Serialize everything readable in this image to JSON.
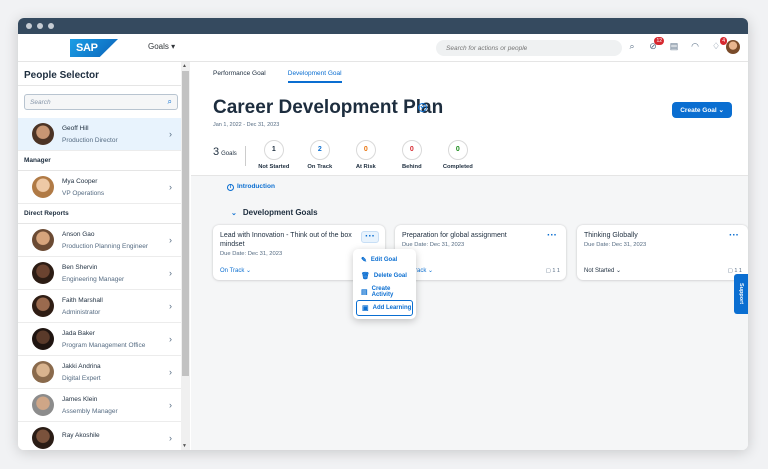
{
  "shell": {
    "logo": "SAP",
    "app_menu": "Goals",
    "search_placeholder": "Search for actions or people",
    "notif_badge": "12",
    "bell_badge": "4"
  },
  "sidebar": {
    "title": "People Selector",
    "search_placeholder": "Search",
    "current": {
      "name": "Geoff Hill",
      "role": "Production Director"
    },
    "manager_heading": "Manager",
    "manager": {
      "name": "Mya Cooper",
      "role": "VP Operations"
    },
    "reports_heading": "Direct Reports",
    "reports": [
      {
        "name": "Anson Gao",
        "role": "Production Planning Engineer"
      },
      {
        "name": "Ben Shervin",
        "role": "Engineering Manager"
      },
      {
        "name": "Faith Marshall",
        "role": "Administrator"
      },
      {
        "name": "Jada Baker",
        "role": "Program Management Office"
      },
      {
        "name": "Jakki Andrina",
        "role": "Digital Expert"
      },
      {
        "name": "James Klein",
        "role": "Assembly Manager"
      },
      {
        "name": "Ray Akoshile",
        "role": ""
      }
    ]
  },
  "main": {
    "tabs": [
      {
        "label": "Performance Goal"
      },
      {
        "label": "Development Goal"
      }
    ],
    "title": "Career Development Plan",
    "date_range": "Jan 1, 2022 - Dec 31, 2023",
    "create_goal_label": "Create Goal",
    "goals_count": "3",
    "goals_label": "Goals",
    "stats": [
      {
        "value": "1",
        "label": "Not Started",
        "color": "#1d2d3e"
      },
      {
        "value": "2",
        "label": "On Track",
        "color": "#0a6ed1"
      },
      {
        "value": "0",
        "label": "At Risk",
        "color": "#e9730c"
      },
      {
        "value": "0",
        "label": "Behind",
        "color": "#d6282f"
      },
      {
        "value": "0",
        "label": "Completed",
        "color": "#188918"
      }
    ],
    "intro_link": "Introduction",
    "section_title": "Development Goals",
    "cards": [
      {
        "title": "Lead with Innovation - Think out of the box mindset",
        "due": "Due Date: Dec 31, 2023",
        "status": "On Track",
        "meta": ""
      },
      {
        "title": "Preparation for global assignment",
        "due": "Due Date: Dec 31, 2023",
        "status": "On Track",
        "meta": "1  1"
      },
      {
        "title": "Thinking Globally",
        "due": "Due Date: Dec 31, 2023",
        "status": "Not Started",
        "meta": "1  1"
      }
    ],
    "menu": [
      {
        "label": "Edit Goal",
        "icon": "pencil-icon"
      },
      {
        "label": "Delete Goal",
        "icon": "trash-icon"
      },
      {
        "label": "Create Activity",
        "icon": "activity-icon"
      },
      {
        "label": "Add Learning",
        "icon": "learning-icon"
      }
    ],
    "support_label": "Support"
  }
}
